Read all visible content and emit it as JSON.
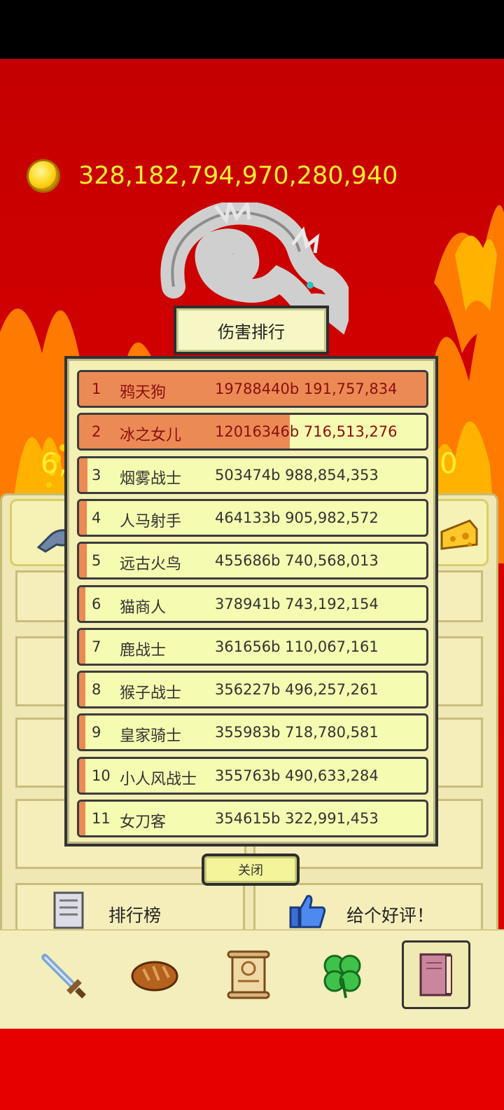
{
  "currency": {
    "coin_amount": "328,182,794,970,280,940"
  },
  "partial_values": {
    "left": "6,",
    "right": "0"
  },
  "modal": {
    "title": "伤害排行",
    "close_label": "关闭",
    "rows": [
      {
        "rank": "1",
        "name": "鸦天狗",
        "damage": "19788440b 191,757,834",
        "bar_fraction": 1.0
      },
      {
        "rank": "2",
        "name": "冰之女儿",
        "damage": "12016346b 716,513,276",
        "bar_fraction": 0.607
      },
      {
        "rank": "3",
        "name": "烟雾战士",
        "damage": "503474b 988,854,353",
        "bar_fraction": 0.025
      },
      {
        "rank": "4",
        "name": "人马射手",
        "damage": "464133b 905,982,572",
        "bar_fraction": 0.023
      },
      {
        "rank": "5",
        "name": "远古火鸟",
        "damage": "455686b 740,568,013",
        "bar_fraction": 0.023
      },
      {
        "rank": "6",
        "name": "猫商人",
        "damage": "378941b 743,192,154",
        "bar_fraction": 0.019
      },
      {
        "rank": "7",
        "name": "鹿战士",
        "damage": "361656b 110,067,161",
        "bar_fraction": 0.018
      },
      {
        "rank": "8",
        "name": "猴子战士",
        "damage": "356227b 496,257,261",
        "bar_fraction": 0.018
      },
      {
        "rank": "9",
        "name": "皇家骑士",
        "damage": "355983b 718,780,581",
        "bar_fraction": 0.018
      },
      {
        "rank": "10",
        "name": "小人风战士",
        "damage": "355763b 490,633,284",
        "bar_fraction": 0.018
      },
      {
        "rank": "11",
        "name": "女刀客",
        "damage": "354615b 322,991,453",
        "bar_fraction": 0.018
      }
    ]
  },
  "menu": {
    "leaderboard_label": "排行榜",
    "rate_label": "给个好评！"
  },
  "nav": {
    "items": [
      {
        "icon": "sword-icon"
      },
      {
        "icon": "bread-icon"
      },
      {
        "icon": "scroll-icon"
      },
      {
        "icon": "clover-icon"
      },
      {
        "icon": "book-icon",
        "active": true
      }
    ]
  },
  "colors": {
    "coin_text": "#ffee33",
    "top_row_fill": "#ec8a55",
    "row_bg": "#f5fbb0"
  }
}
